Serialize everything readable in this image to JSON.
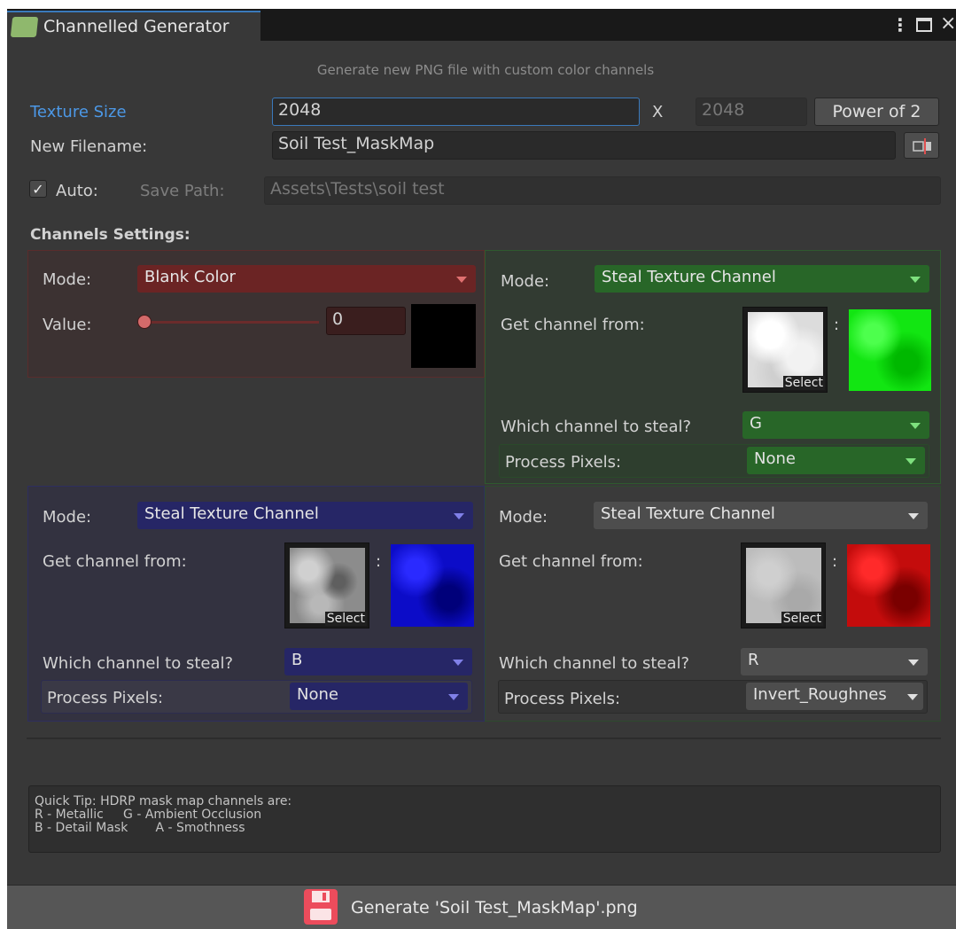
{
  "window": {
    "tab_title": "Channelled Generator",
    "menu_icon": "kebab-menu-icon",
    "maximize_icon": "maximize-icon",
    "close_icon": "close-icon",
    "close_glyph": "×",
    "menu_glyph": "⋮"
  },
  "header": {
    "subtitle": "Generate new PNG file with custom color channels"
  },
  "texture": {
    "size_label": "Texture Size",
    "width": "2048",
    "x_label": "X",
    "height": "2048",
    "power_button": "Power of 2",
    "filename_label": "New Filename:",
    "filename": "Soil Test_MaskMap",
    "auto_label": "Auto:",
    "auto_checked": true,
    "save_path_label": "Save Path:",
    "save_path": "Assets\\Tests\\soil test",
    "check_glyph": "✓"
  },
  "channels_heading": "Channels Settings:",
  "channels": {
    "red": {
      "mode_label": "Mode:",
      "mode": "Blank Color",
      "value_label": "Value:",
      "value": "0",
      "slider_value": 0,
      "color": "#7a2a2a"
    },
    "green": {
      "mode_label": "Mode:",
      "mode": "Steal Texture Channel",
      "get_label": "Get channel from:",
      "select_label": "Select",
      "colon": ":",
      "which_label": "Which channel to steal?",
      "which": "G",
      "process_label": "Process Pixels:",
      "process": "None",
      "color": "#2f6e2f"
    },
    "blue": {
      "mode_label": "Mode:",
      "mode": "Steal Texture Channel",
      "get_label": "Get channel from:",
      "select_label": "Select",
      "colon": ":",
      "which_label": "Which channel to steal?",
      "which": "B",
      "process_label": "Process Pixels:",
      "process": "None",
      "color": "#2b2b66"
    },
    "alpha": {
      "mode_label": "Mode:",
      "mode": "Steal Texture Channel",
      "get_label": "Get channel from:",
      "select_label": "Select",
      "colon": ":",
      "which_label": "Which channel to steal?",
      "which": "R",
      "process_label": "Process Pixels:",
      "process": "Invert_Roughnes",
      "color": "#4d4d4d"
    }
  },
  "tip": {
    "line1": "Quick Tip: HDRP mask map channels are:",
    "line2": "R - Metallic     G - Ambient Occlusion",
    "line3": "B - Detail Mask       A - Smothness"
  },
  "generate": {
    "label": "Generate 'Soil Test_MaskMap'.png",
    "icon": "floppy-disk-icon"
  }
}
